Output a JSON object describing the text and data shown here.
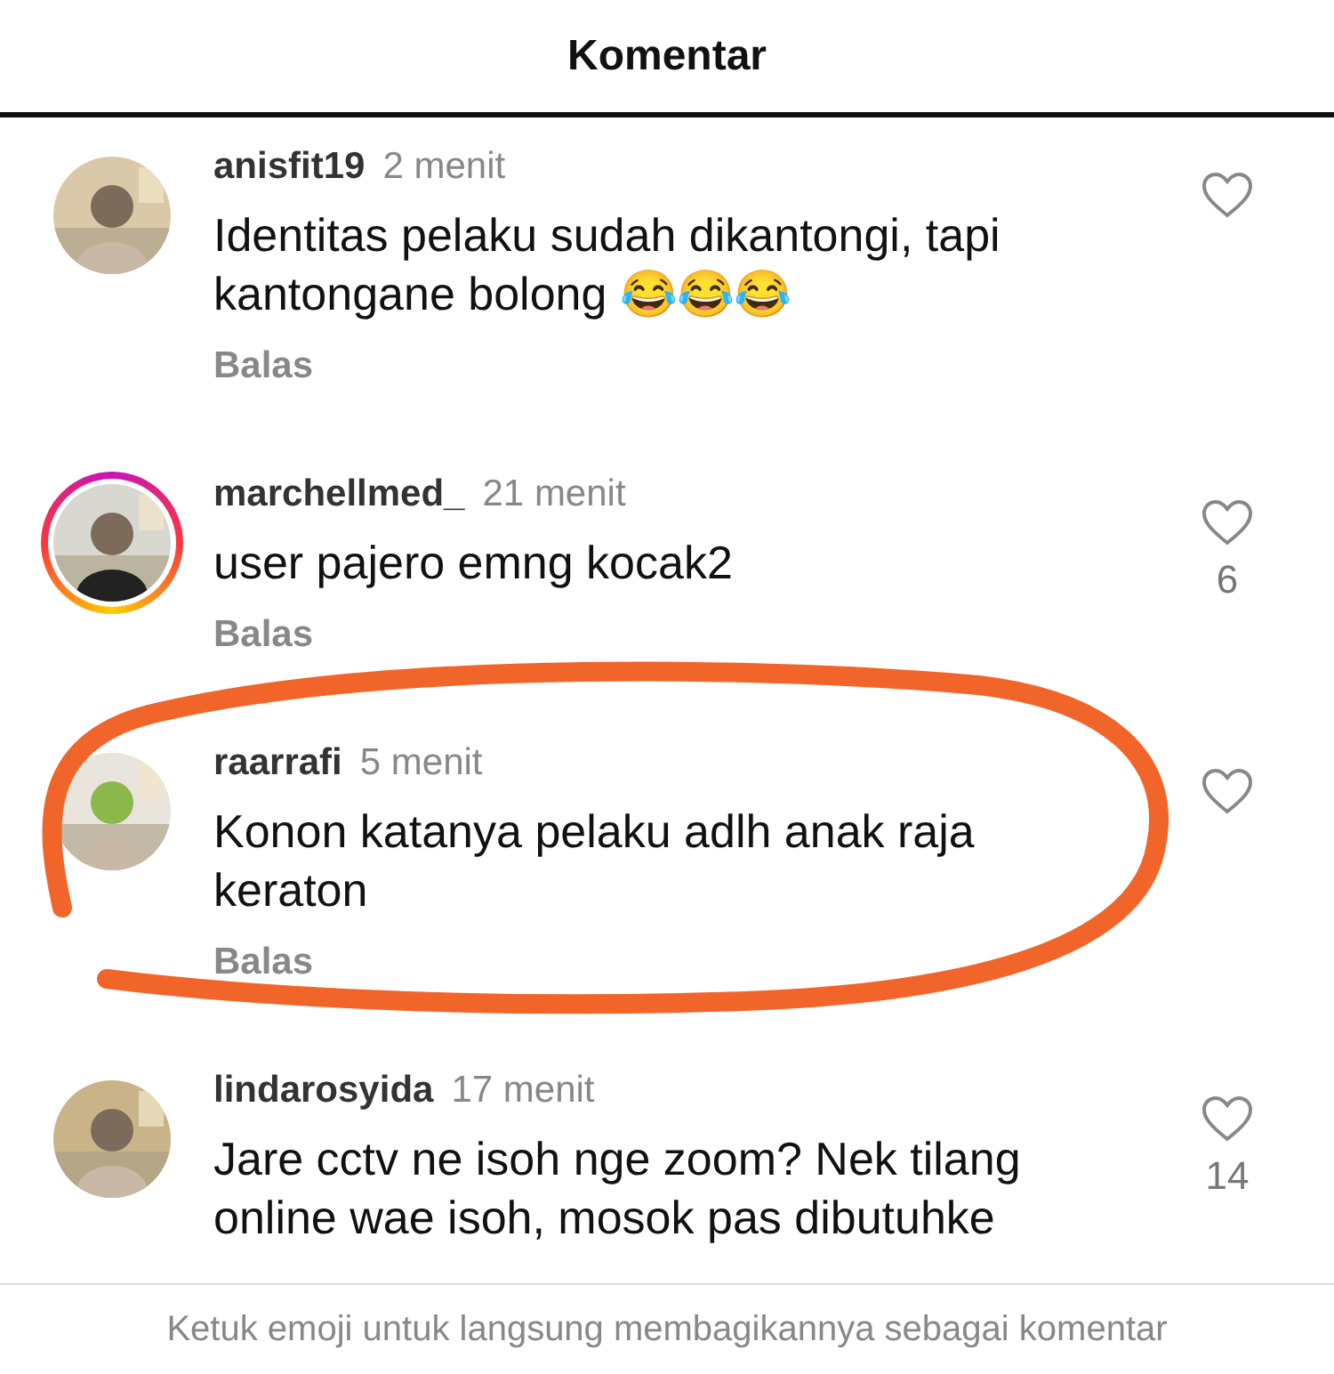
{
  "header": {
    "title": "Komentar"
  },
  "comments": [
    {
      "username": "anisfit19",
      "time": "2 menit",
      "text": "Identitas pelaku sudah dikantongi, tapi kantongane bolong 😂😂😂",
      "reply": "Balas",
      "story_ring": false
    },
    {
      "username": "marchellmed_",
      "time": "21 menit",
      "text": "user pajero emng kocak2",
      "reply": "Balas",
      "story_ring": true,
      "likes": "6"
    },
    {
      "username": "raarrafi",
      "time": "5 menit",
      "text": "Konon katanya pelaku adlh anak raja keraton",
      "reply": "Balas",
      "story_ring": false,
      "highlighted": true
    },
    {
      "username": "lindarosyida",
      "time": "17 menit",
      "text": "Jare cctv ne isoh nge zoom? Nek tilang online wae isoh, mosok pas dibutuhke",
      "story_ring": false,
      "likes": "14"
    }
  ],
  "footer": {
    "hint": "Ketuk emoji untuk langsung membagikannya sebagai komentar"
  }
}
